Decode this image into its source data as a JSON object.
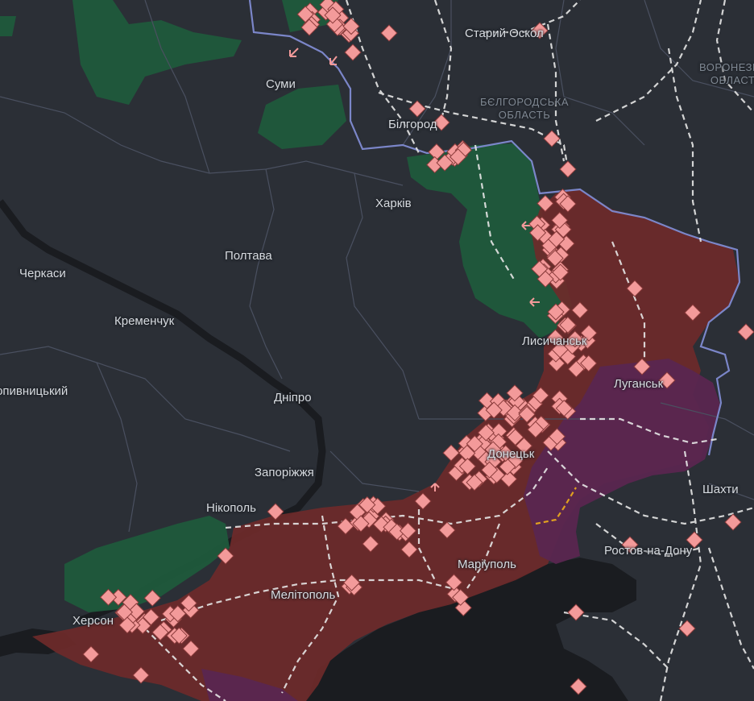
{
  "cities": {
    "sumy": "Суми",
    "staryi_oskil": "Старий Оскол",
    "bilhorod": "Білгород",
    "kharkiv": "Харків",
    "poltava": "Полтава",
    "cherkasy": "Черкаси",
    "kremenchuk": "Кременчук",
    "kropyvnytskyi": "Кропивницький",
    "dnipro": "Дніпро",
    "zaporizhzhia": "Запоріжжя",
    "nikopol": "Нікополь",
    "kherson": "Херсон",
    "melitopol": "Мелітополь",
    "mariupol": "Маріуполь",
    "lysychansk": "Лисичанськ",
    "luhansk": "Луганськ",
    "donetsk": "Донецьк",
    "shakhty": "Шахти",
    "rostov": "Ростов-на-Дону"
  },
  "regions": {
    "belgorod_line1": "БЄЛГОРОДСЬКА",
    "belgorod_line2": "ОБЛАСТЬ",
    "voronezh_line1": "ВОРОНЕЗЬКА",
    "voronezh_line2": "ОБЛАСТЬ"
  },
  "colors": {
    "background": "#2b2f36",
    "water": "#1a1c20",
    "occupied": "#6e2a2a",
    "occupied_before_2022": "#5a2650",
    "liberated": "#1f5a3c",
    "border": "#7b86c9",
    "marker": "#f39a9a",
    "railway": "#e8e8e8"
  },
  "legend_icons": {
    "marker": "diamond-marker-icon",
    "arrow": "attack-arrow-icon"
  }
}
